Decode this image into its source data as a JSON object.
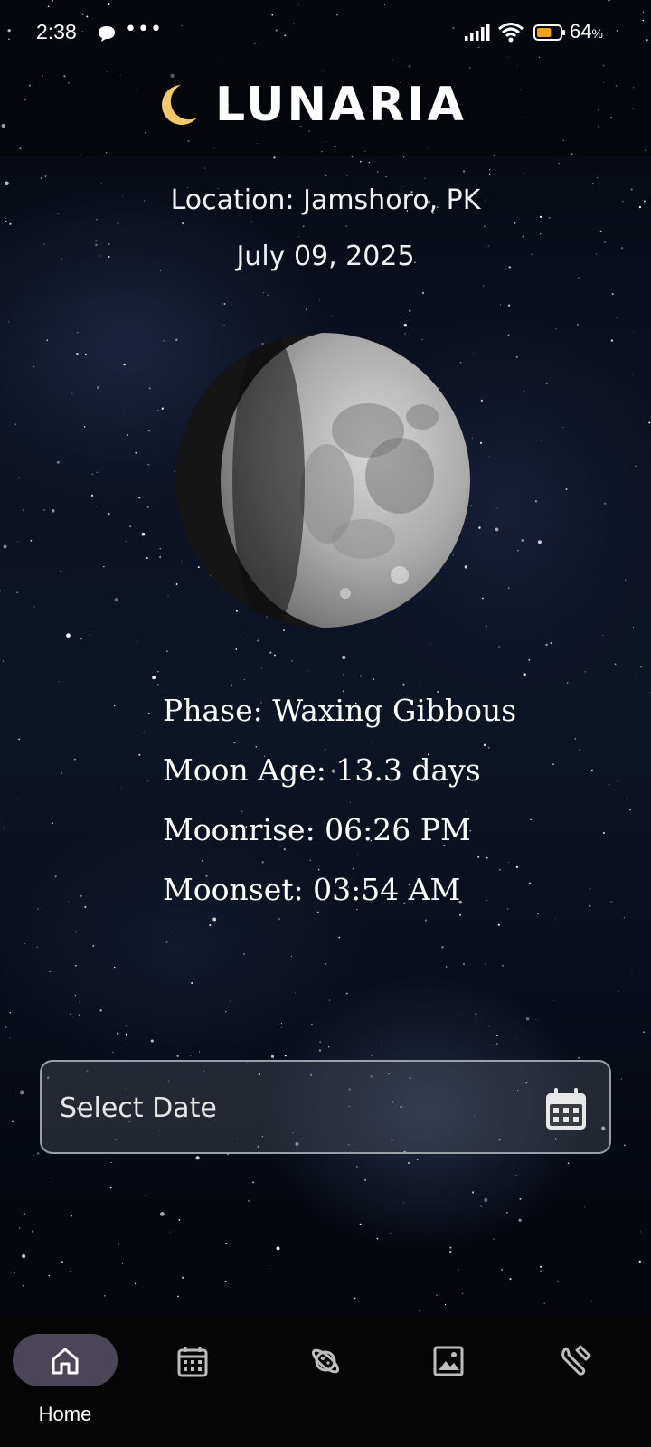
{
  "status_bar": {
    "time": "2:38",
    "overflow_dots": "•••",
    "battery_percent": "64",
    "battery_unit": "%",
    "battery_level": 0.64,
    "icons": [
      "chat-icon",
      "signal-icon",
      "wifi-icon",
      "battery-icon"
    ]
  },
  "header": {
    "app_name": "LUNARIA",
    "logo_icon": "crescent-moon-icon",
    "logo_color": "#f3c96a"
  },
  "location": "Location: Jamshoro, PK",
  "date": "July 09, 2025",
  "moon": {
    "phase": "Phase: Waxing Gibbous",
    "age": "Moon Age: 13.3 days",
    "moonrise": "Moonrise: 06:26 PM",
    "moonset": "Moonset: 03:54 AM"
  },
  "date_picker": {
    "placeholder": "Select Date",
    "icon": "calendar-icon"
  },
  "bottom_nav": {
    "items": [
      {
        "label": "Home",
        "icon": "home-icon",
        "active": true
      },
      {
        "label": "",
        "icon": "calendar-icon",
        "active": false
      },
      {
        "label": "",
        "icon": "planet-icon",
        "active": false
      },
      {
        "label": "",
        "icon": "image-icon",
        "active": false
      },
      {
        "label": "",
        "icon": "wrench-icon",
        "active": false
      }
    ],
    "active_color": "#4a4657"
  }
}
